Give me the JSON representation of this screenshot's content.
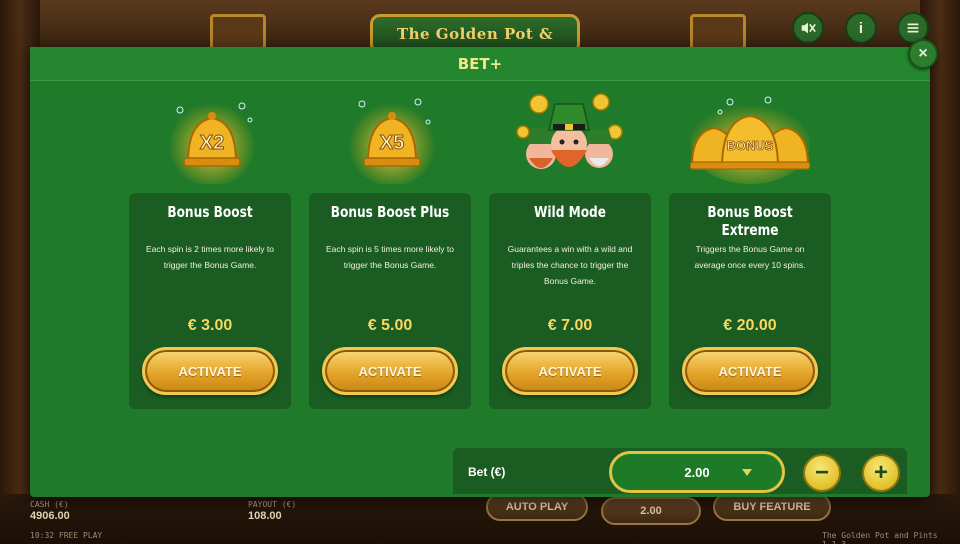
{
  "game": {
    "logo_text": "The Golden Pot & Pints",
    "info_label": "i"
  },
  "modal": {
    "title": "BET+",
    "close_label": "×"
  },
  "cards": [
    {
      "title": "Bonus Boost",
      "description": "Each spin is 2 times more likely to trigger the Bonus Game.",
      "price": "€ 3.00",
      "button": "ACTIVATE",
      "art_text": "X2",
      "art_icon": "bell-x2-icon"
    },
    {
      "title": "Bonus Boost Plus",
      "description": "Each spin is 5 times more likely to trigger the Bonus Game.",
      "price": "€ 5.00",
      "button": "ACTIVATE",
      "art_text": "X5",
      "art_icon": "bell-x5-icon"
    },
    {
      "title": "Wild Mode",
      "description": "Guarantees a win with a wild and triples the chance to trigger the Bonus Game.",
      "price": "€ 7.00",
      "button": "ACTIVATE",
      "art_text": "",
      "art_icon": "leprechauns-icon"
    },
    {
      "title": "Bonus Boost Extreme",
      "description": "Triggers the Bonus Game on average once every 10 spins.",
      "price": "€ 20.00",
      "button": "ACTIVATE",
      "art_text": "BONUS",
      "art_icon": "bonus-bells-icon"
    }
  ],
  "bet": {
    "label": "Bet (€)",
    "value": "2.00",
    "minus_label": "−",
    "plus_label": "+"
  },
  "bottom_bar": {
    "cash_label": "CASH (€)",
    "cash_value": "4906.00",
    "payout_label": "PAYOUT (€)",
    "payout_value": "108.00",
    "auto_play_label": "AUTO PLAY",
    "bet_value": "2.00",
    "buy_feature_label": "BUY FEATURE",
    "clock_text": "10:32 FREE PLAY",
    "footer_right": "The Golden Pot and Pints 1.1.3"
  },
  "colors": {
    "modal_bg": "#1f7a2a",
    "card_bg": "#1a5c22",
    "title_yellow": "#f5e889",
    "price_yellow": "#f7d95e",
    "button_gold": "#e4a52a"
  }
}
